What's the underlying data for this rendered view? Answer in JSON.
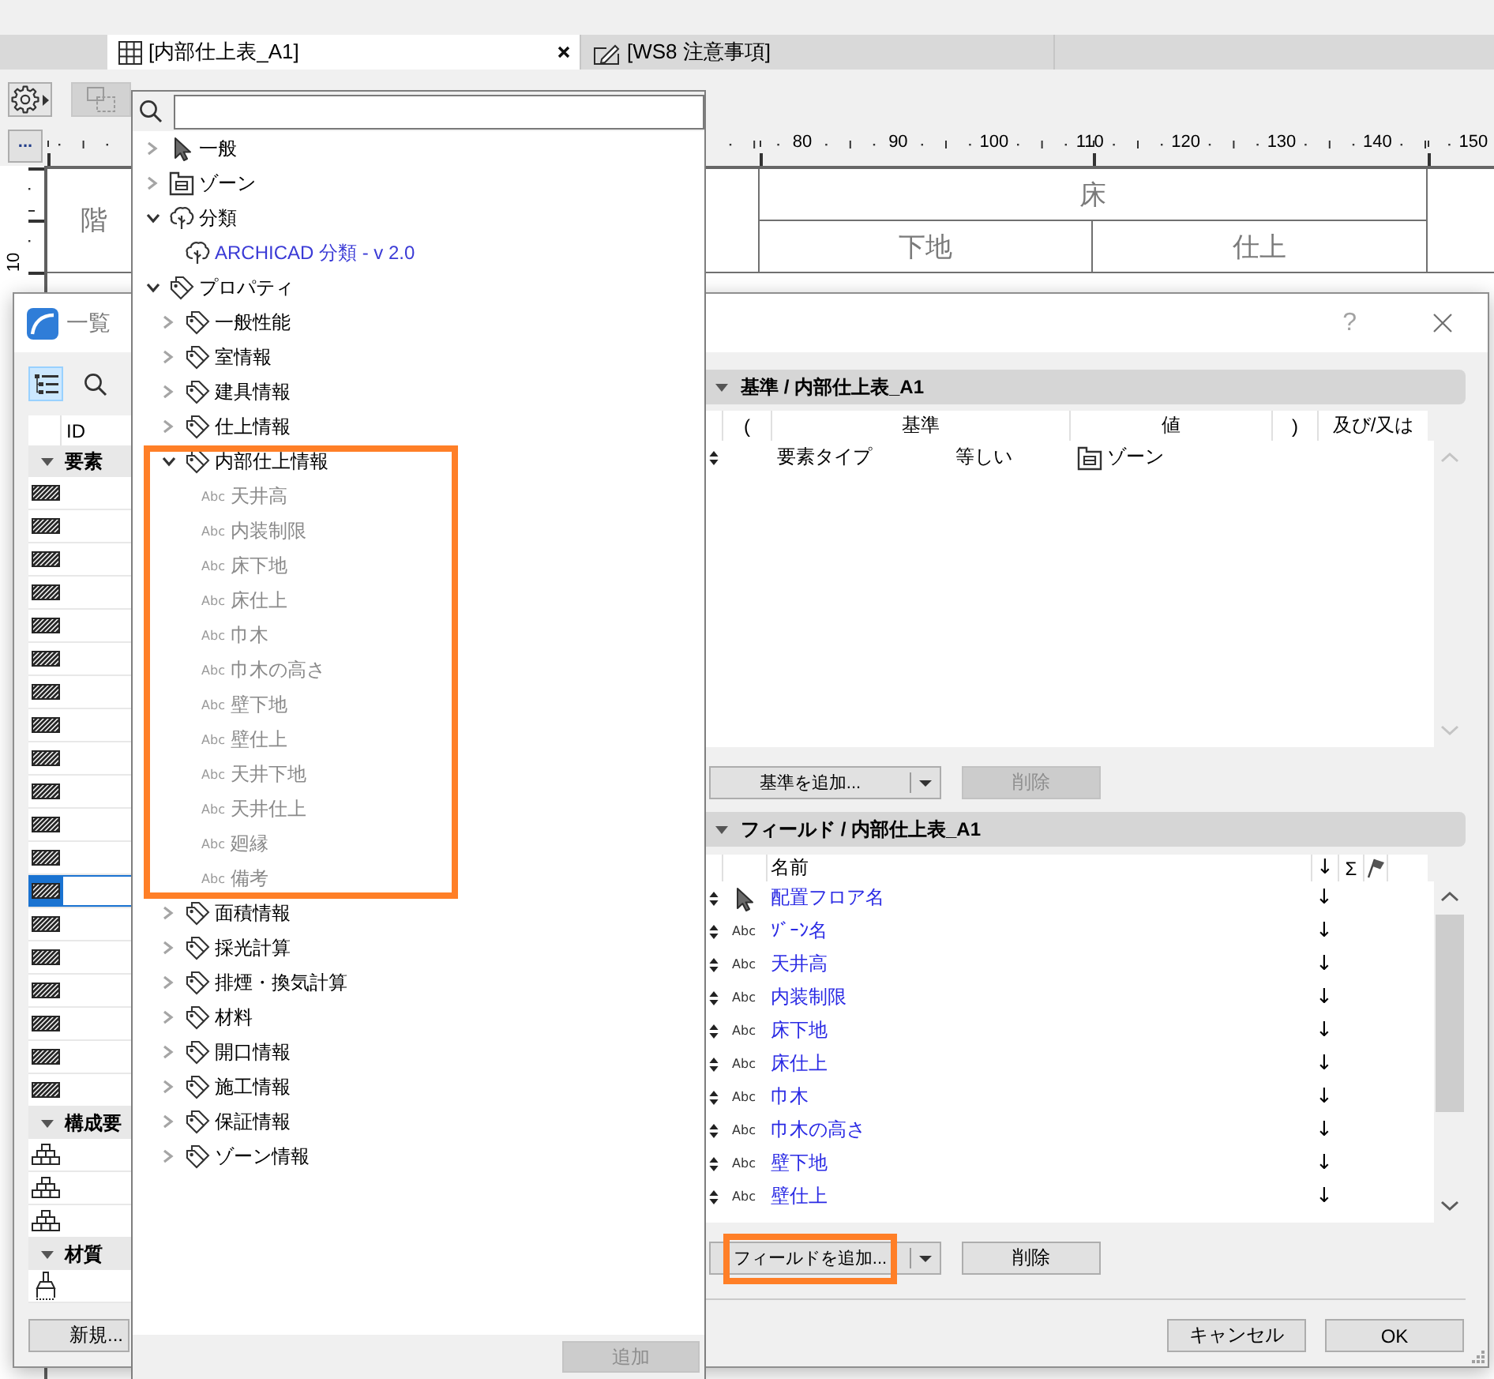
{
  "app": {
    "tabs": [
      {
        "kind": "schedule",
        "label": "[内部仕上表_A1]",
        "selected": true
      },
      {
        "kind": "worksheet",
        "label": "[WS8 注意事項]",
        "selected": false
      }
    ],
    "toolbar": [
      {
        "kind": "settings",
        "disabled": false
      },
      {
        "kind": "frame",
        "disabled": true
      }
    ],
    "ruler": {
      "more": "...",
      "labels": [
        "80",
        "90",
        "100",
        "110",
        "120",
        "130",
        "140",
        "150"
      ],
      "side_label": "10"
    },
    "schedule_headings": [
      {
        "label": "階"
      },
      {
        "label": "床",
        "children": [
          {
            "label": "下地"
          },
          {
            "label": "仕上"
          }
        ]
      }
    ]
  },
  "picker": {
    "tree": [
      {
        "kind": "general",
        "label": "一般",
        "expanded": false,
        "disabled": false
      },
      {
        "kind": "zone",
        "label": "ゾーン",
        "expanded": false,
        "disabled": false
      },
      {
        "kind": "classification",
        "label": "分類",
        "expanded": true,
        "disabled": false,
        "children": [
          {
            "kind": "classification_system",
            "label": "ARCHICAD 分類 - v 2.0",
            "disabled": false
          }
        ]
      },
      {
        "kind": "property_group",
        "label": "プロパティ",
        "expanded": true,
        "disabled": false,
        "children": [
          {
            "kind": "property_group",
            "label": "一般性能",
            "expanded": false,
            "disabled": false,
            "highlighted": false
          },
          {
            "kind": "property_group",
            "label": "室情報",
            "expanded": false,
            "disabled": false,
            "highlighted": false
          },
          {
            "kind": "property_group",
            "label": "建具情報",
            "expanded": false,
            "disabled": false,
            "highlighted": false
          },
          {
            "kind": "property_group",
            "label": "仕上情報",
            "expanded": false,
            "disabled": false,
            "highlighted": false
          },
          {
            "kind": "property_group",
            "label": "内部仕上情報",
            "expanded": true,
            "disabled": false,
            "highlighted": true,
            "children": [
              {
                "kind": "property",
                "type_label": "Abc",
                "label": "天井高",
                "disabled": true
              },
              {
                "kind": "property",
                "type_label": "Abc",
                "label": "内装制限",
                "disabled": true
              },
              {
                "kind": "property",
                "type_label": "Abc",
                "label": "床下地",
                "disabled": true
              },
              {
                "kind": "property",
                "type_label": "Abc",
                "label": "床仕上",
                "disabled": true
              },
              {
                "kind": "property",
                "type_label": "Abc",
                "label": "巾木",
                "disabled": true
              },
              {
                "kind": "property",
                "type_label": "Abc",
                "label": "巾木の高さ",
                "disabled": true
              },
              {
                "kind": "property",
                "type_label": "Abc",
                "label": "壁下地",
                "disabled": true
              },
              {
                "kind": "property",
                "type_label": "Abc",
                "label": "壁仕上",
                "disabled": true
              },
              {
                "kind": "property",
                "type_label": "Abc",
                "label": "天井下地",
                "disabled": true
              },
              {
                "kind": "property",
                "type_label": "Abc",
                "label": "天井仕上",
                "disabled": true
              },
              {
                "kind": "property",
                "type_label": "Abc",
                "label": "廻縁",
                "disabled": true
              },
              {
                "kind": "property",
                "type_label": "Abc",
                "label": "備考",
                "disabled": true
              }
            ]
          },
          {
            "kind": "property_group",
            "label": "面積情報",
            "expanded": false,
            "disabled": false,
            "highlighted": false
          },
          {
            "kind": "property_group",
            "label": "採光計算",
            "expanded": false,
            "disabled": false,
            "highlighted": false
          },
          {
            "kind": "property_group",
            "label": "排煙・換気計算",
            "expanded": false,
            "disabled": false,
            "highlighted": false
          },
          {
            "kind": "property_group",
            "label": "材料",
            "expanded": false,
            "disabled": false,
            "highlighted": false
          },
          {
            "kind": "property_group",
            "label": "開口情報",
            "expanded": false,
            "disabled": false,
            "highlighted": false
          },
          {
            "kind": "property_group",
            "label": "施工情報",
            "expanded": false,
            "disabled": false,
            "highlighted": false
          },
          {
            "kind": "property_group",
            "label": "保証情報",
            "expanded": false,
            "disabled": false,
            "highlighted": false
          },
          {
            "kind": "property_group",
            "label": "ゾーン情報",
            "expanded": false,
            "disabled": false,
            "highlighted": false
          }
        ]
      }
    ],
    "add_button": {
      "label": "追加",
      "disabled": true
    }
  },
  "dialog": {
    "title": "一覧",
    "help": "?",
    "side_panel": {
      "tools": [
        {
          "kind": "list-view",
          "selected": true
        },
        {
          "kind": "search",
          "selected": false
        }
      ],
      "column": "ID",
      "groups": [
        {
          "kind": "fill",
          "label": "要素",
          "expanded": true,
          "rows": [
            {
              "selected": false
            },
            {
              "selected": false
            },
            {
              "selected": false
            },
            {
              "selected": false
            },
            {
              "selected": false
            },
            {
              "selected": false
            },
            {
              "selected": false
            },
            {
              "selected": false
            },
            {
              "selected": false
            },
            {
              "selected": false
            },
            {
              "selected": false
            },
            {
              "selected": false
            },
            {
              "selected": true
            },
            {
              "selected": false
            },
            {
              "selected": false
            },
            {
              "selected": false
            },
            {
              "selected": false
            },
            {
              "selected": false
            },
            {
              "selected": false
            }
          ]
        },
        {
          "kind": "composite",
          "label": "構成要",
          "expanded": true,
          "rows": [
            {
              "selected": false
            },
            {
              "selected": false
            },
            {
              "selected": false
            }
          ]
        },
        {
          "kind": "surface",
          "label": "材質",
          "expanded": true,
          "rows": [
            {
              "selected": false
            }
          ]
        }
      ],
      "new_button": "新規..."
    },
    "criteria": {
      "title": "基準 / 内部仕上表_A1",
      "expanded": true,
      "columns": [
        "(",
        "基準",
        "値",
        ")",
        "及び/又は"
      ],
      "rows": [
        {
          "criterion": "要素タイプ",
          "operator": "等しい",
          "value": {
            "kind": "zone",
            "label": "ゾーン"
          }
        }
      ],
      "add_button": {
        "label": "基準を追加...",
        "highlighted": false
      },
      "delete_button": {
        "label": "削除",
        "disabled": true
      }
    },
    "fields": {
      "title": "フィールド / 内部仕上表_A1",
      "expanded": true,
      "columns": [
        "名前",
        "↓",
        "Σ"
      ],
      "rows": [
        {
          "kind": "element",
          "name": "配置フロア名",
          "order": "↓"
        },
        {
          "kind": "property",
          "type_label": "Abc",
          "name": "ｿﾞｰﾝ名",
          "order": "↓"
        },
        {
          "kind": "property",
          "type_label": "Abc",
          "name": "天井高",
          "order": "↓"
        },
        {
          "kind": "property",
          "type_label": "Abc",
          "name": "内装制限",
          "order": "↓"
        },
        {
          "kind": "property",
          "type_label": "Abc",
          "name": "床下地",
          "order": "↓"
        },
        {
          "kind": "property",
          "type_label": "Abc",
          "name": "床仕上",
          "order": "↓"
        },
        {
          "kind": "property",
          "type_label": "Abc",
          "name": "巾木",
          "order": "↓"
        },
        {
          "kind": "property",
          "type_label": "Abc",
          "name": "巾木の高さ",
          "order": "↓"
        },
        {
          "kind": "property",
          "type_label": "Abc",
          "name": "壁下地",
          "order": "↓"
        },
        {
          "kind": "property",
          "type_label": "Abc",
          "name": "壁仕上",
          "order": "↓"
        }
      ],
      "add_button": {
        "label": "フィールドを追加...",
        "highlighted": true
      },
      "delete_button": {
        "label": "削除",
        "disabled": false
      }
    },
    "footer": [
      {
        "label": "キャンセル"
      },
      {
        "label": "OK"
      }
    ]
  }
}
